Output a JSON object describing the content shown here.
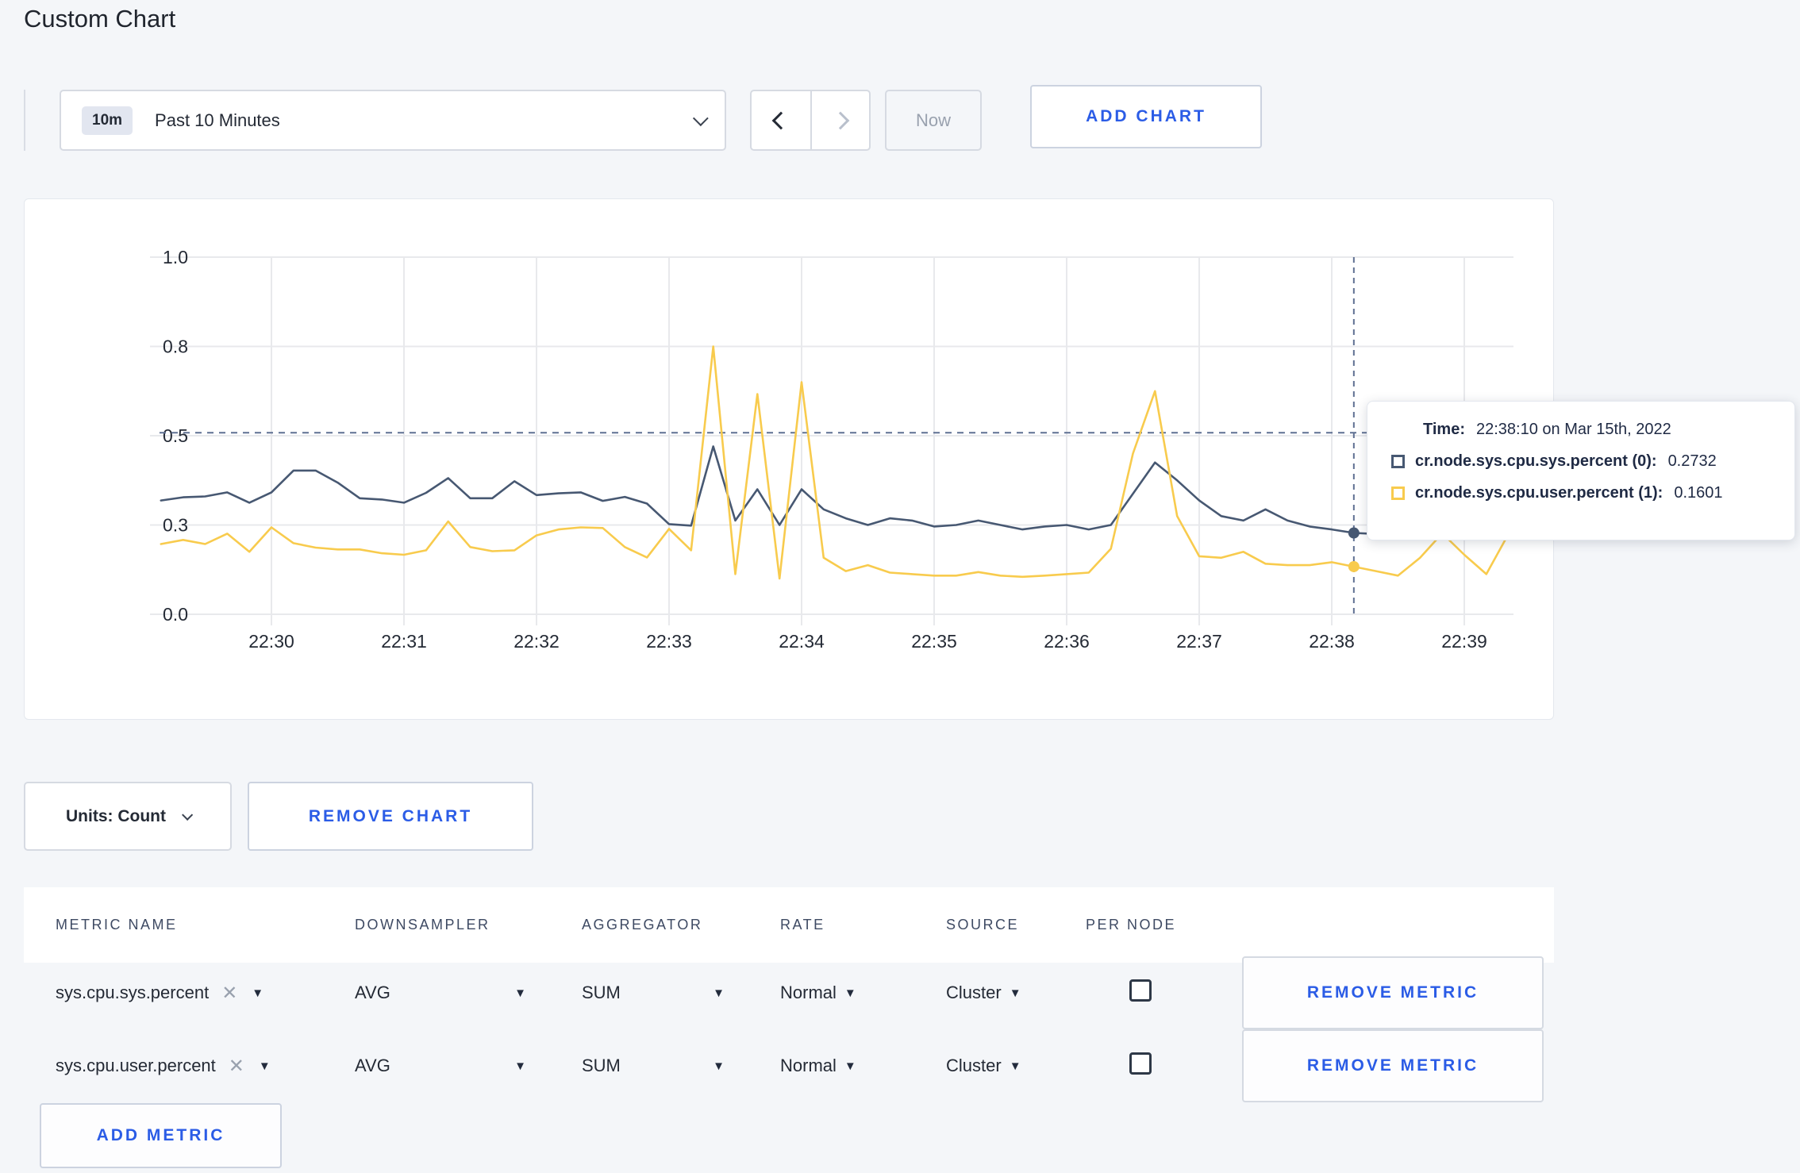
{
  "page": {
    "title": "Custom Chart"
  },
  "colors": {
    "accent_blue": "#2b5ce6",
    "series_sys": "#475872",
    "series_user": "#f8cb4d",
    "gridline": "#e8e9ec",
    "dashed": "#5f7092",
    "text_dark": "#242a35"
  },
  "toolbar": {
    "time_range": {
      "badge": "10m",
      "label": "Past 10 Minutes"
    },
    "now_label": "Now",
    "add_chart_label": "ADD CHART"
  },
  "chart_controls": {
    "units_label": "Units: Count",
    "remove_chart_label": "REMOVE CHART"
  },
  "tooltip": {
    "time_label": "Time:",
    "time_value": "22:38:10 on Mar 15th, 2022",
    "series": [
      {
        "label": "cr.node.sys.cpu.sys.percent (0):",
        "value": "0.2732",
        "color": "#475872"
      },
      {
        "label": "cr.node.sys.cpu.user.percent (1):",
        "value": "0.1601",
        "color": "#f8cb4d"
      }
    ]
  },
  "metrics_table": {
    "headers": [
      "METRIC NAME",
      "DOWNSAMPLER",
      "AGGREGATOR",
      "RATE",
      "SOURCE",
      "PER NODE"
    ],
    "remove_metric_label": "REMOVE METRIC",
    "add_metric_label": "ADD METRIC",
    "rows": [
      {
        "metric": "sys.cpu.sys.percent",
        "downsampler": "AVG",
        "aggregator": "SUM",
        "rate": "Normal",
        "source": "Cluster",
        "per_node": false
      },
      {
        "metric": "sys.cpu.user.percent",
        "downsampler": "AVG",
        "aggregator": "SUM",
        "rate": "Normal",
        "source": "Cluster",
        "per_node": false
      }
    ]
  },
  "chart_data": {
    "type": "line",
    "title": "",
    "xlabel": "",
    "ylabel": "",
    "grid": true,
    "x_start": "22:29:10",
    "x_interval_seconds": 10,
    "x_tick_labels": [
      "22:30",
      "22:31",
      "22:32",
      "22:33",
      "22:34",
      "22:35",
      "22:36",
      "22:37",
      "22:38",
      "22:39"
    ],
    "y_tick_labels": [
      "1.0",
      "0.8",
      "0.5",
      "0.3",
      "0.0"
    ],
    "y_tick_values": [
      1.0,
      0.8,
      0.5,
      0.3,
      0.0
    ],
    "max_dashed_line_value": 0.51,
    "crosshair": {
      "time": "22:38:10",
      "x_index": 54
    },
    "series": [
      {
        "name": "cr.node.sys.cpu.sys.percent",
        "color": "#475872",
        "crosshair_value": 0.2732,
        "values": [
          0.355,
          0.362,
          0.364,
          0.373,
          0.35,
          0.373,
          0.422,
          0.422,
          0.395,
          0.36,
          0.357,
          0.35,
          0.372,
          0.405,
          0.36,
          0.36,
          0.398,
          0.367,
          0.371,
          0.373,
          0.354,
          0.363,
          0.348,
          0.302,
          0.298,
          0.476,
          0.31,
          0.38,
          0.3,
          0.38,
          0.335,
          0.315,
          0.3,
          0.315,
          0.31,
          0.295,
          0.3,
          0.31,
          0.3,
          0.285,
          0.295,
          0.3,
          0.285,
          0.3,
          0.37,
          0.44,
          0.4,
          0.355,
          0.32,
          0.31,
          0.335,
          0.31,
          0.295,
          0.285,
          0.2732,
          0.27,
          0.28,
          0.285,
          0.275,
          0.29,
          0.3,
          0.295
        ]
      },
      {
        "name": "cr.node.sys.cpu.user.percent",
        "color": "#f8cb4d",
        "crosshair_value": 0.1601,
        "values": [
          0.236,
          0.25,
          0.236,
          0.271,
          0.21,
          0.292,
          0.239,
          0.224,
          0.218,
          0.218,
          0.205,
          0.2,
          0.215,
          0.308,
          0.226,
          0.212,
          0.215,
          0.265,
          0.285,
          0.292,
          0.29,
          0.226,
          0.191,
          0.287,
          0.215,
          0.8,
          0.135,
          0.64,
          0.12,
          0.68,
          0.19,
          0.145,
          0.165,
          0.14,
          0.135,
          0.13,
          0.13,
          0.142,
          0.13,
          0.126,
          0.13,
          0.135,
          0.14,
          0.22,
          0.46,
          0.65,
          0.32,
          0.195,
          0.19,
          0.21,
          0.17,
          0.165,
          0.165,
          0.175,
          0.1601,
          0.145,
          0.13,
          0.19,
          0.272,
          0.2,
          0.135,
          0.27
        ]
      }
    ]
  }
}
